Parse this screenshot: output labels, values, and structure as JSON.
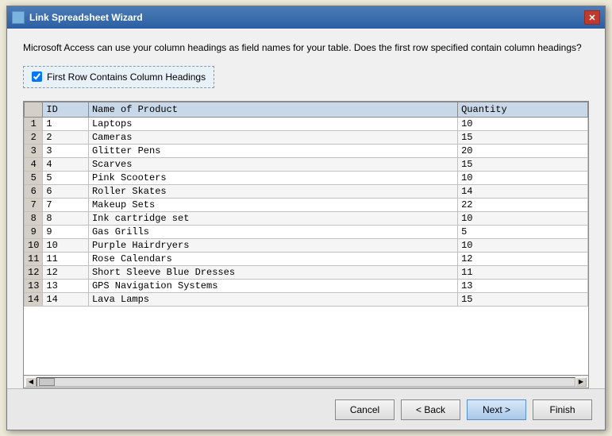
{
  "window": {
    "title": "Link Spreadsheet Wizard",
    "close_label": "✕"
  },
  "description": {
    "text": "Microsoft Access can use your column headings as field names for your table. Does the first row specified contain column headings?"
  },
  "checkbox": {
    "label": "First Row Contains Column Headings",
    "checked": true
  },
  "table": {
    "columns": [
      {
        "key": "row_num",
        "label": ""
      },
      {
        "key": "id",
        "label": "ID"
      },
      {
        "key": "name",
        "label": "Name of Product"
      },
      {
        "key": "quantity",
        "label": "Quantity"
      }
    ],
    "rows": [
      {
        "row_num": "1",
        "id": "1",
        "name": "Laptops",
        "quantity": "10"
      },
      {
        "row_num": "2",
        "id": "2",
        "name": "Cameras",
        "quantity": "15"
      },
      {
        "row_num": "3",
        "id": "3",
        "name": "Glitter Pens",
        "quantity": "20"
      },
      {
        "row_num": "4",
        "id": "4",
        "name": "Scarves",
        "quantity": "15"
      },
      {
        "row_num": "5",
        "id": "5",
        "name": "Pink Scooters",
        "quantity": "10"
      },
      {
        "row_num": "6",
        "id": "6",
        "name": "Roller Skates",
        "quantity": "14"
      },
      {
        "row_num": "7",
        "id": "7",
        "name": "Makeup Sets",
        "quantity": "22"
      },
      {
        "row_num": "8",
        "id": "8",
        "name": "Ink cartridge set",
        "quantity": "10"
      },
      {
        "row_num": "9",
        "id": "9",
        "name": "Gas Grills",
        "quantity": "5"
      },
      {
        "row_num": "10",
        "id": "10",
        "name": "Purple Hairdryers",
        "quantity": "10"
      },
      {
        "row_num": "11",
        "id": "11",
        "name": "Rose Calendars",
        "quantity": "12"
      },
      {
        "row_num": "12",
        "id": "12",
        "name": "Short Sleeve Blue Dresses",
        "quantity": "11"
      },
      {
        "row_num": "13",
        "id": "13",
        "name": "GPS Navigation Systems",
        "quantity": "13"
      },
      {
        "row_num": "14",
        "id": "14",
        "name": "Lava Lamps",
        "quantity": "15"
      }
    ]
  },
  "footer": {
    "cancel_label": "Cancel",
    "back_label": "< Back",
    "next_label": "Next >",
    "finish_label": "Finish"
  }
}
